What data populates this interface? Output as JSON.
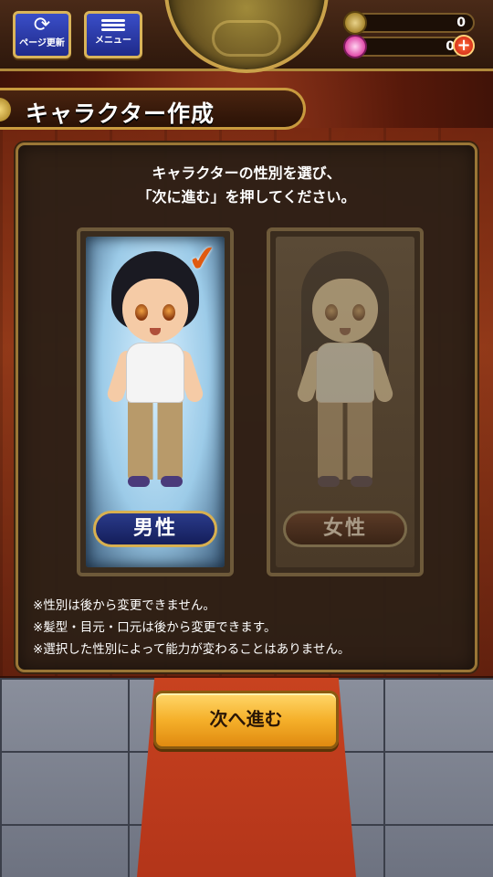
{
  "header": {
    "refresh_label": "ページ更新",
    "menu_label": "メニュー",
    "coin_value": "0",
    "gem_value": "0",
    "add_label": "+"
  },
  "title": "キャラクター作成",
  "instruction_line1": "キャラクターの性別を選び、",
  "instruction_line2": "「次に進む」を押してください。",
  "options": {
    "male": {
      "label": "男性",
      "selected": true
    },
    "female": {
      "label": "女性",
      "selected": false
    }
  },
  "notes": [
    "※性別は後から変更できません。",
    "※髪型・目元・口元は後から変更できます。",
    "※選択した性別によって能力が変わることはありません。"
  ],
  "next_button": "次へ進む",
  "colors": {
    "accent_gold": "#d8b050",
    "male_label_bg": "#1f2a8a",
    "next_button": "#f5b02a"
  }
}
